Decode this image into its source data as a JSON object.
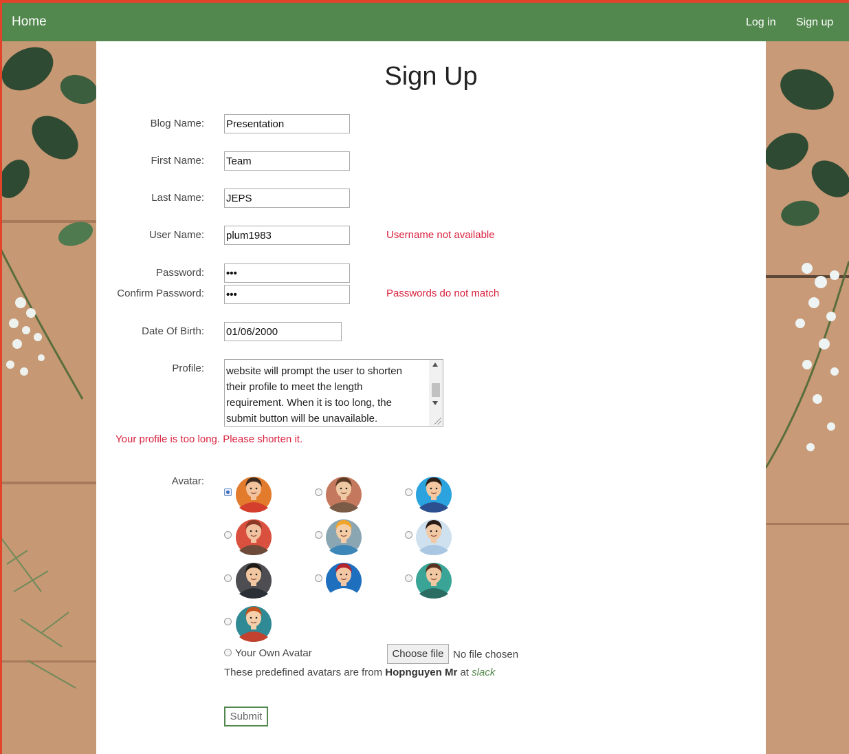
{
  "nav": {
    "home": "Home",
    "login": "Log in",
    "signup": "Sign up"
  },
  "form": {
    "title": "Sign Up",
    "blog_name": {
      "label": "Blog Name:",
      "value": "Presentation"
    },
    "first_name": {
      "label": "First Name:",
      "value": "Team"
    },
    "last_name": {
      "label": "Last Name:",
      "value": "JEPS"
    },
    "user_name": {
      "label": "User Name:",
      "value": "plum1983",
      "error": "Username not available"
    },
    "password": {
      "label": "Password:",
      "value": "•••"
    },
    "confirm_password": {
      "label": "Confirm Password:",
      "value": "•••",
      "error": "Passwords do not match"
    },
    "dob": {
      "label": "Date Of Birth:",
      "value": "01/06/2000"
    },
    "profile": {
      "label": "Profile:",
      "visible_lines": [
        "website will prompt the user to shorten",
        "their profile to meet the length",
        "requirement. When it is too long, the",
        "submit button will be unavailable."
      ],
      "error": "Your profile is too long. Please shorten it."
    },
    "avatar": {
      "label": "Avatar:",
      "options": [
        {
          "name": "man-headset-avatar",
          "skin": "#f2c39c",
          "bg": "#e37b2d",
          "shirt": "#d33f2c",
          "hair": "#3a2a1f",
          "selected": true
        },
        {
          "name": "man-suit-brown-avatar",
          "skin": "#efc9a3",
          "bg": "#c4785e",
          "shirt": "#7a5b46",
          "hair": "#5b3b26",
          "selected": false
        },
        {
          "name": "man-suit-blue-avatar",
          "skin": "#f4c9a2",
          "bg": "#2aa3df",
          "shirt": "#2c4f8f",
          "hair": "#2e1e15",
          "selected": false
        },
        {
          "name": "woman-red-hair-avatar",
          "skin": "#f2c2a0",
          "bg": "#d9503f",
          "shirt": "#6d4a3a",
          "hair": "#8c3a25",
          "selected": false
        },
        {
          "name": "man-blond-avatar",
          "skin": "#f4cca6",
          "bg": "#8ba6b3",
          "shirt": "#3c86b8",
          "hair": "#f3a52b",
          "selected": false
        },
        {
          "name": "man-beard-avatar",
          "skin": "#f2c9a5",
          "bg": "#cfe1ef",
          "shirt": "#a9c7e3",
          "hair": "#2a1c15",
          "selected": false
        },
        {
          "name": "man-dark-suit-avatar",
          "skin": "#f1c7a2",
          "bg": "#4e4e52",
          "shirt": "#2b3036",
          "hair": "#1d1a18",
          "selected": false
        },
        {
          "name": "woman-red-bob-avatar",
          "skin": "#f4c7a4",
          "bg": "#1f6fbf",
          "shirt": "#ffffff",
          "hair": "#b5232c",
          "selected": false
        },
        {
          "name": "man-glasses-avatar",
          "skin": "#f1c8a1",
          "bg": "#3aa596",
          "shirt": "#2b6c63",
          "hair": "#5a3320",
          "selected": false
        },
        {
          "name": "woman-ginger-avatar",
          "skin": "#f6cfab",
          "bg": "#2f8a95",
          "shirt": "#c2422f",
          "hair": "#c2531f",
          "selected": false
        }
      ],
      "own_avatar_label": "Your Own Avatar",
      "choose_file": "Choose file",
      "no_file": "No file chosen",
      "credit_prefix": "These predefined avatars are from",
      "credit_author": "Hopnguyen Mr",
      "credit_at": "at",
      "credit_site": "slack"
    },
    "submit": "Submit"
  },
  "colors": {
    "nav": "#52884e",
    "error": "#d9213e",
    "accent_line": "#e2442a"
  }
}
